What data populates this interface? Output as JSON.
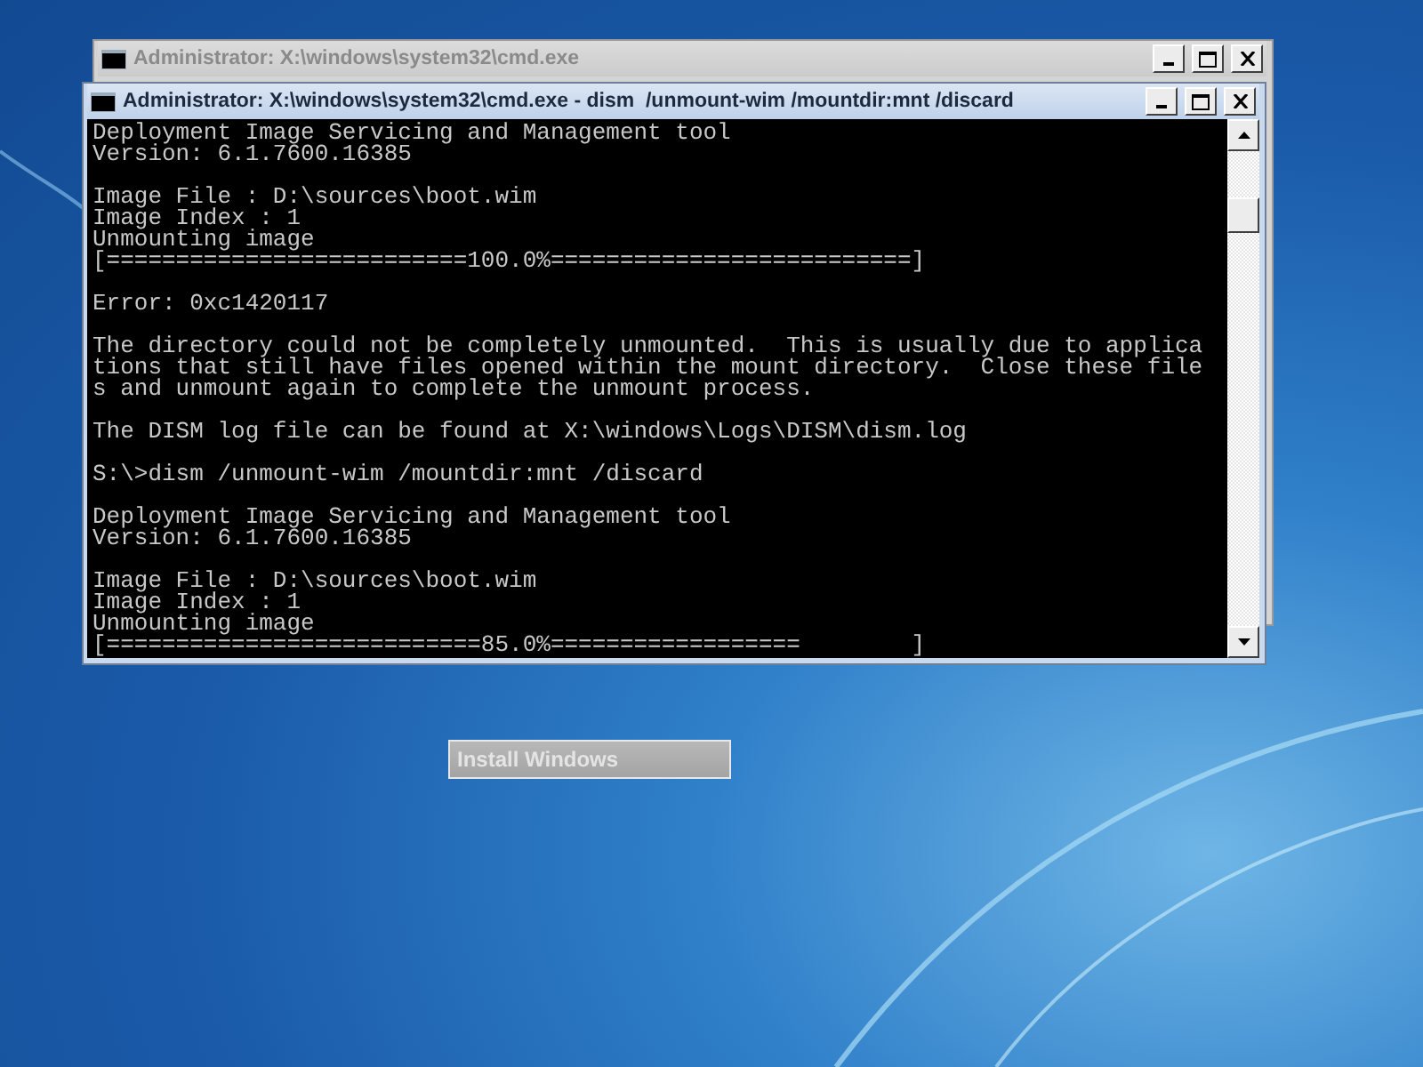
{
  "back_window": {
    "title": "Administrator: X:\\windows\\system32\\cmd.exe",
    "active": false
  },
  "front_window": {
    "title": "Administrator: X:\\windows\\system32\\cmd.exe - dism  /unmount-wim /mountdir:mnt /discard",
    "active": true,
    "console_blocks": [
      [
        "Deployment Image Servicing and Management tool",
        "Version: 6.1.7600.16385"
      ],
      [
        "Image File : D:\\sources\\boot.wim",
        "Image Index : 1",
        "Unmounting image",
        "[==========================100.0%==========================]"
      ],
      [
        "Error: 0xc1420117"
      ],
      [
        "The directory could not be completely unmounted.  This is usually due to applica",
        "tions that still have files opened within the mount directory.  Close these file",
        "s and unmount again to complete the unmount process."
      ],
      [
        "The DISM log file can be found at X:\\windows\\Logs\\DISM\\dism.log"
      ],
      [
        "S:\\>dism /unmount-wim /mountdir:mnt /discard"
      ],
      [
        "Deployment Image Servicing and Management tool",
        "Version: 6.1.7600.16385"
      ],
      [
        "Image File : D:\\sources\\boot.wim",
        "Image Index : 1",
        "Unmounting image",
        "[===========================85.0%==================        ]"
      ]
    ]
  },
  "install_button": {
    "label": "Install Windows",
    "disabled": true
  }
}
